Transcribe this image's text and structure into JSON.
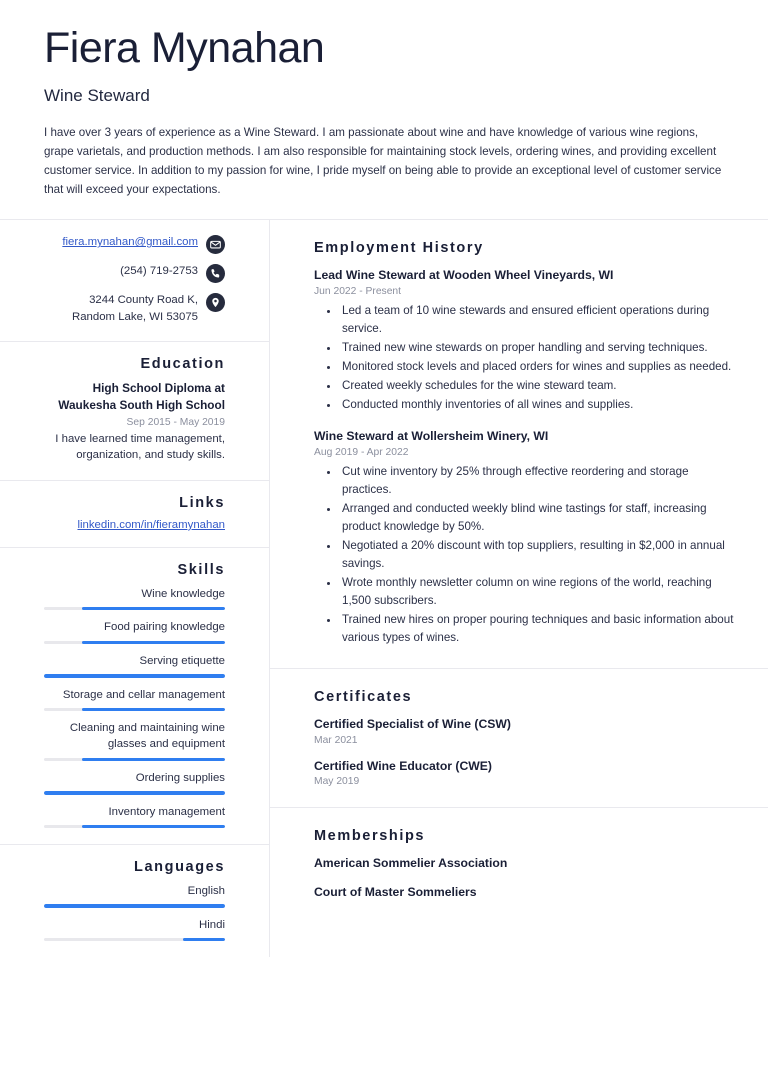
{
  "header": {
    "full_name": "Fiera Mynahan",
    "job_title": "Wine Steward",
    "summary": "I have over 3 years of experience as a Wine Steward. I am passionate about wine and have knowledge of various wine regions, grape varietals, and production methods. I am also responsible for maintaining stock levels, ordering wines, and providing excellent customer service. In addition to my passion for wine, I pride myself on being able to provide an exceptional level of customer service that will exceed your expectations."
  },
  "theme": {
    "accent_blue": "#2f7ef0",
    "link_blue": "#3258c8",
    "heading_navy": "#1a1f36",
    "muted_gray": "#8b8f9e",
    "divider": "#e9e9ee",
    "track_gray": "#e8e8ec"
  },
  "contact": {
    "items": [
      {
        "icon": "envelope-icon",
        "text": "fiera.mynahan@gmail.com",
        "is_link": true
      },
      {
        "icon": "phone-icon",
        "text": "(254) 719-2753",
        "is_link": false
      },
      {
        "icon": "location-pin-icon",
        "text": "3244 County Road K, Random Lake, WI 53075",
        "is_link": false
      }
    ]
  },
  "education": {
    "title": "Education",
    "entries": [
      {
        "degree": "High School Diploma at Waukesha South High School",
        "dates": "Sep 2015 - May 2019",
        "description": "I have learned time management, organization, and study skills."
      }
    ]
  },
  "links": {
    "title": "Links",
    "items": [
      {
        "label": "linkedin.com/in/fieramynahan"
      }
    ]
  },
  "skills": {
    "title": "Skills",
    "items": [
      {
        "label": "Wine knowledge",
        "level": 79
      },
      {
        "label": "Food pairing knowledge",
        "level": 79
      },
      {
        "label": "Serving etiquette",
        "level": 100
      },
      {
        "label": "Storage and cellar management",
        "level": 79
      },
      {
        "label": "Cleaning and maintaining wine glasses and equipment",
        "level": 79
      },
      {
        "label": "Ordering supplies",
        "level": 100
      },
      {
        "label": "Inventory management",
        "level": 79
      }
    ]
  },
  "languages": {
    "title": "Languages",
    "items": [
      {
        "label": "English",
        "level": 100
      },
      {
        "label": "Hindi",
        "level": 23
      }
    ]
  },
  "employment": {
    "title": "Employment History",
    "entries": [
      {
        "title": "Lead Wine Steward at Wooden Wheel Vineyards, WI",
        "dates": "Jun 2022 - Present",
        "bullets": [
          "Led a team of 10 wine stewards and ensured efficient operations during service.",
          "Trained new wine stewards on proper handling and serving techniques.",
          "Monitored stock levels and placed orders for wines and supplies as needed.",
          "Created weekly schedules for the wine steward team.",
          "Conducted monthly inventories of all wines and supplies."
        ]
      },
      {
        "title": "Wine Steward at Wollersheim Winery, WI",
        "dates": "Aug 2019 - Apr 2022",
        "bullets": [
          "Cut wine inventory by 25% through effective reordering and storage practices.",
          "Arranged and conducted weekly blind wine tastings for staff, increasing product knowledge by 50%.",
          "Negotiated a 20% discount with top suppliers, resulting in $2,000 in annual savings.",
          "Wrote monthly newsletter column on wine regions of the world, reaching 1,500 subscribers.",
          "Trained new hires on proper pouring techniques and basic information about various types of wines."
        ]
      }
    ]
  },
  "certificates": {
    "title": "Certificates",
    "entries": [
      {
        "name": "Certified Specialist of Wine (CSW)",
        "date": "Mar 2021"
      },
      {
        "name": "Certified Wine Educator (CWE)",
        "date": "May 2019"
      }
    ]
  },
  "memberships": {
    "title": "Memberships",
    "entries": [
      {
        "name": "American Sommelier Association"
      },
      {
        "name": "Court of Master Sommeliers"
      }
    ]
  }
}
